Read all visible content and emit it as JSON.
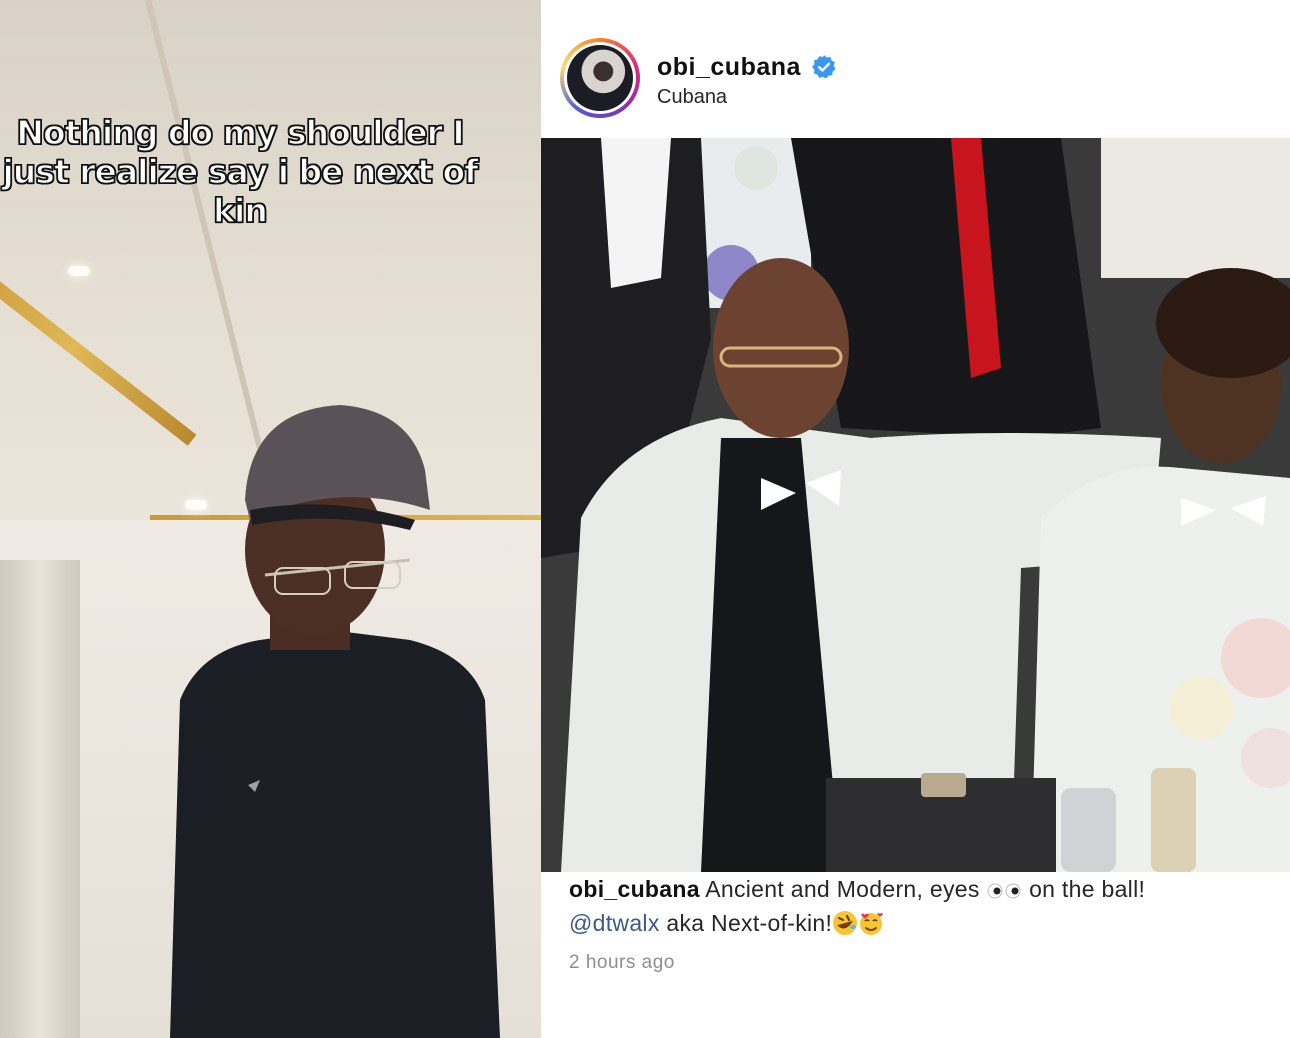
{
  "left_panel": {
    "overlay_lines": [
      "Nothing do my shoulder I",
      "just realize say i be next of",
      "kin"
    ]
  },
  "post": {
    "username": "obi_cubana",
    "verified_icon": "verified-badge-icon",
    "subtitle": "Cubana",
    "caption": {
      "username": "obi_cubana",
      "text_part1": "Ancient and Modern, eyes",
      "eyes_icon": "eyes-emoji-icon",
      "text_part2": "on the ball!",
      "mention": "@dtwalx",
      "text_part3": "aka Next-of-kin!",
      "emoji_icons": [
        "rolling-laughing-emoji-icon",
        "smiling-hearts-emoji-icon"
      ]
    },
    "timestamp": "2 hours ago"
  },
  "colors": {
    "verified": "#3897f0",
    "mention": "#3b5a8a",
    "timestamp": "#8e8e8e"
  }
}
